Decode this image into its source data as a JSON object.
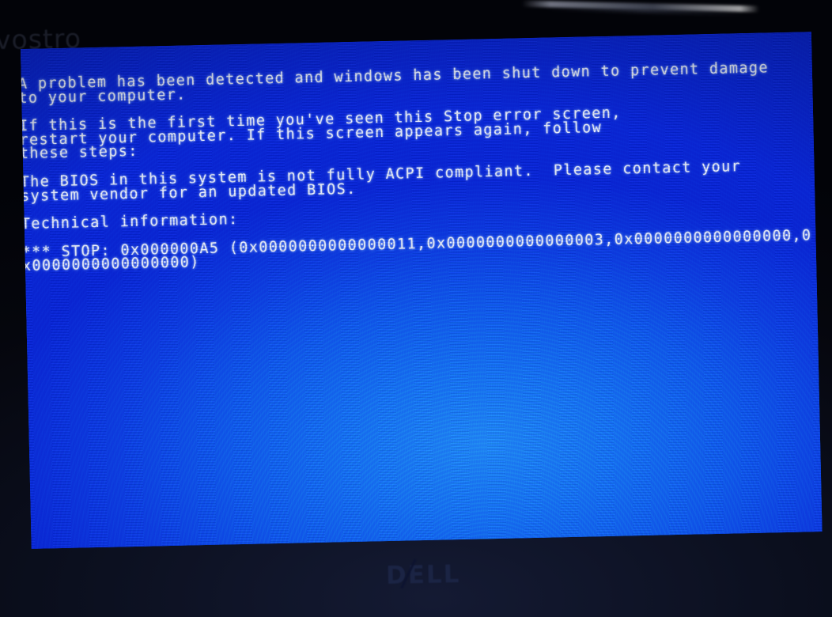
{
  "device": {
    "brand_top": "vostro",
    "brand_bottom": "DELL"
  },
  "colors": {
    "bsod_blue": "#0d53f2",
    "bsod_blue_dark": "#0625dd",
    "text": "#eef3ff",
    "bezel": "#05060c"
  },
  "bsod": {
    "paragraphs": [
      {
        "name": "intro-paragraph",
        "lines": [
          "A problem has been detected and windows has been shut down to prevent damage",
          "to your computer."
        ]
      },
      {
        "name": "first-time-paragraph",
        "lines": [
          "If this is the first time you've seen this Stop error screen,",
          "restart your computer. If this screen appears again, follow",
          "these steps:"
        ]
      },
      {
        "name": "bios-acpi-paragraph",
        "lines": [
          "The BIOS in this system is not fully ACPI compliant.  Please contact your",
          "system vendor for an updated BIOS."
        ]
      },
      {
        "name": "technical-information-heading",
        "lines": [
          "Technical information:"
        ]
      },
      {
        "name": "stop-code-paragraph",
        "lines": [
          "*** STOP: 0x000000A5 (0x0000000000000011,0x0000000000000003,0x0000000000000000,0",
          "x0000000000000000)"
        ]
      }
    ],
    "stop_code": "0x000000A5",
    "stop_parameters": [
      "0x0000000000000011",
      "0x0000000000000003",
      "0x0000000000000000",
      "0x0000000000000000"
    ]
  }
}
